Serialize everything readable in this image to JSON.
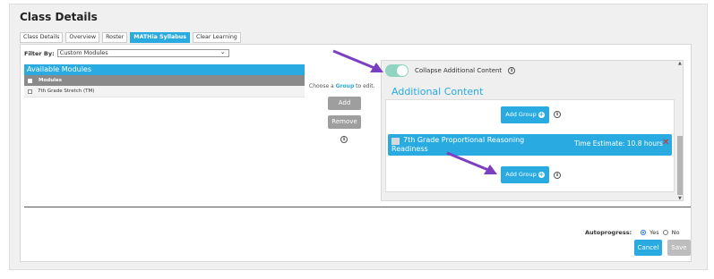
{
  "page": {
    "title": "Class Details"
  },
  "tabs": [
    {
      "label": "Class Details",
      "active": false
    },
    {
      "label": "Overview",
      "active": false
    },
    {
      "label": "Roster",
      "active": false
    },
    {
      "label": "MATHia Syllabus",
      "active": true
    },
    {
      "label": "Clear Learning",
      "active": false
    }
  ],
  "filter": {
    "label": "Filter By:",
    "value": "Custom Modules"
  },
  "available_modules": {
    "header": "Available Modules",
    "column_header": "Modules",
    "items": [
      {
        "label": "7th Grade Stretch (TM)",
        "checked": false
      }
    ]
  },
  "group_controls": {
    "hint_prefix": "Choose a",
    "hint_link": "Group",
    "hint_suffix": "to edit.",
    "add_label": "Add",
    "remove_label": "Remove",
    "info_glyph": "i"
  },
  "additional": {
    "collapse_label": "Collapse Additional Content",
    "collapse_on": true,
    "title": "Additional Content",
    "add_group_label": "Add Group",
    "plus_glyph": "+",
    "groups": [
      {
        "name_line1": "7th Grade Proportional Reasoning",
        "name_line2": "Readiness",
        "time_estimate": "Time Estimate: 10.8 hours",
        "remove_glyph": "✕"
      }
    ]
  },
  "autoprogress": {
    "label": "Autoprogress:",
    "yes_label": "Yes",
    "no_label": "No",
    "selected": "Yes"
  },
  "footer": {
    "cancel_label": "Cancel",
    "save_label": "Save"
  },
  "colors": {
    "accent": "#29abe2",
    "arrow": "#7b3fc4",
    "toggle": "#8fd3c0",
    "remove": "#e02424"
  },
  "icons": [
    "info-icon",
    "plus-circle-icon",
    "close-icon",
    "chevron-down-icon",
    "annotation-arrow"
  ]
}
